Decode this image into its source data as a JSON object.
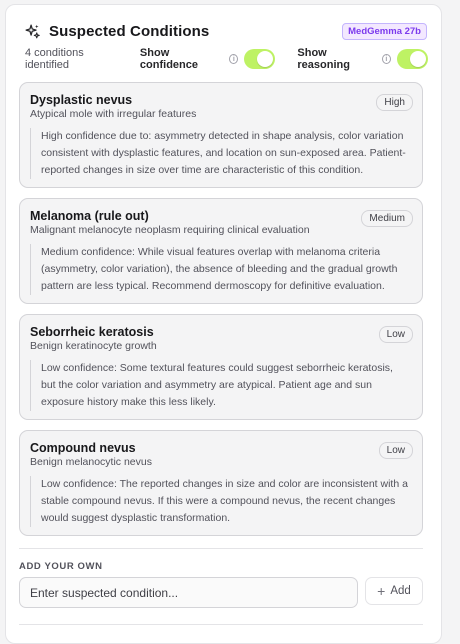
{
  "header": {
    "title": "Suspected Conditions",
    "model_badge": "MedGemma 27b"
  },
  "controls": {
    "count_text": "4 conditions identified",
    "show_confidence_label": "Show confidence",
    "show_confidence_on": true,
    "show_reasoning_label": "Show reasoning",
    "show_reasoning_on": true,
    "accent_color": "#bef264"
  },
  "conditions": [
    {
      "name": "Dysplastic nevus",
      "description": "Atypical mole with irregular features",
      "confidence": "High",
      "reasoning": "High confidence due to: asymmetry detected in shape analysis, color variation consistent with dysplastic features, and location on sun-exposed area. Patient-reported changes in size over time are characteristic of this condition."
    },
    {
      "name": "Melanoma (rule out)",
      "description": "Malignant melanocyte neoplasm requiring clinical evaluation",
      "confidence": "Medium",
      "reasoning": "Medium confidence: While visual features overlap with melanoma criteria (asymmetry, color variation), the absence of bleeding and the gradual growth pattern are less typical. Recommend dermoscopy for definitive evaluation."
    },
    {
      "name": "Seborrheic keratosis",
      "description": "Benign keratinocyte growth",
      "confidence": "Low",
      "reasoning": "Low confidence: Some textural features could suggest seborrheic keratosis, but the color variation and asymmetry are atypical. Patient age and sun exposure history make this less likely."
    },
    {
      "name": "Compound nevus",
      "description": "Benign melanocytic nevus",
      "confidence": "Low",
      "reasoning": "Low confidence: The reported changes in size and color are inconsistent with a stable compound nevus. If this were a compound nevus, the recent changes would suggest dysplastic transformation."
    }
  ],
  "add_own": {
    "section_label": "ADD YOUR OWN",
    "placeholder": "Enter suspected condition...",
    "button_label": "Add",
    "button_icon": "plus-icon"
  }
}
